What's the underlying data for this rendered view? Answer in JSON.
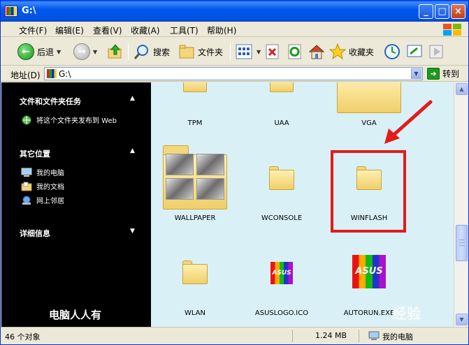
{
  "window": {
    "title": "G:\\",
    "buttons": {
      "minimize": "_",
      "maximize": "□",
      "close": "×"
    }
  },
  "menu": {
    "items": [
      "文件(F)",
      "编辑(E)",
      "查看(V)",
      "收藏(A)",
      "工具(T)",
      "帮助(H)"
    ]
  },
  "toolbar": {
    "back_label": "后退",
    "search_label": "搜索",
    "folders_label": "文件夹",
    "favorites_label": "收藏夹"
  },
  "address": {
    "label": "地址(D)",
    "value": "G:\\",
    "go_label": "转到"
  },
  "left_pane": {
    "file_tasks": {
      "title": "文件和文件夹任务",
      "items": [
        "将这个文件夹发布到 Web"
      ]
    },
    "other_places": {
      "title": "其它位置",
      "items": [
        "我的电脑",
        "我的文档",
        "网上邻居"
      ]
    },
    "details": {
      "title": "详细信息"
    },
    "watermark": "电脑人人有"
  },
  "files": [
    {
      "name": "TPM",
      "kind": "folder"
    },
    {
      "name": "UAA",
      "kind": "folder"
    },
    {
      "name": "VGA",
      "kind": "folder"
    },
    {
      "name": "WALLPAPER",
      "kind": "folder-thumbnails"
    },
    {
      "name": "WCONSOLE",
      "kind": "folder"
    },
    {
      "name": "WINFLASH",
      "kind": "folder",
      "highlighted": true
    },
    {
      "name": "WLAN",
      "kind": "folder"
    },
    {
      "name": "ASUSLOGO.ICO",
      "kind": "asus-ico"
    },
    {
      "name": "AUTORUN.EXE",
      "kind": "asus-exe"
    }
  ],
  "asus_logo_text": "ASUS",
  "status": {
    "objects": "46 个对象",
    "size": "1.24 MB",
    "location": "我的电脑"
  },
  "watermark_right": "经验",
  "colors": {
    "content_bg": "#d9f1f6",
    "highlight": "#e21b1b",
    "left_pane_bg": "#000000"
  }
}
